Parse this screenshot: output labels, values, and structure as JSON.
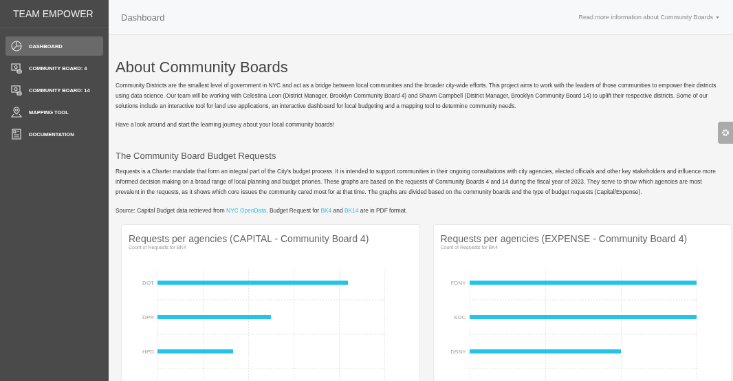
{
  "sidebar": {
    "brand": "TEAM EMPOWER",
    "items": [
      {
        "label": "DASHBOARD",
        "kind": "pie",
        "selected": true
      },
      {
        "label": "COMMUNITY BOARD: 4",
        "kind": "board",
        "selected": false
      },
      {
        "label": "COMMUNITY BOARD: 14",
        "kind": "board",
        "selected": false
      },
      {
        "label": "MAPPING TOOL",
        "kind": "map",
        "selected": false
      },
      {
        "label": "DOCUMENTATION",
        "kind": "doc",
        "selected": false
      }
    ]
  },
  "header": {
    "title": "Dashboard",
    "menu": "Read more information about Community Boards"
  },
  "about": {
    "title": "About Community Boards",
    "paragraphs": [
      "Community Districts are the smallest level of government in NYC and act as a bridge between local communities and the broader city-wide efforts. This project aims to work with the leaders of those communities to empower their districts using data science. Our team will be working with Celestina Leon (District Manager, Brooklyn Community Board 4) and Shawn Campbell (District Manager, Brooklyn Community Board 14) to uplift their respective districts. Some of our solutions include an interactive tool for land use applications, an interactive dashboard for local budgeting and a mapping tool to determine community needs.",
      "Have a look around and start the learning journey about your local community boards!"
    ]
  },
  "budget": {
    "title": "The Community Board Budget Requests",
    "paragraph": "Requests is a Charter mandate that form an integral part of the City's budget process. It is intended to support communities in their ongoing consultations with city agencies, elected officials and other key stakeholders and influence more informed decision making on a broad range of local planning and budget priories. These graphs are based on the requests of Community Boards 4 and 14 during the fiscal year of 2023. They serve to show which agencies are most prevalent in the requests, as it shows which core issues the community cared most for at that time. The graphs are divided based on the community boards and the type of budget requests (Capital/Expense).",
    "source": [
      {
        "text": "Source: Capital Budget data retrieved from ",
        "link": false
      },
      {
        "text": "NYC OpenData",
        "link": true
      },
      {
        "text": ". Budget Request for ",
        "link": false
      },
      {
        "text": "BK4",
        "link": true
      },
      {
        "text": " and ",
        "link": false
      },
      {
        "text": "BK14",
        "link": true
      },
      {
        "text": " are in PDF format.",
        "link": false
      }
    ]
  },
  "charts": [
    {
      "title": "Requests per agencies (CAPITAL - Community Board 4)",
      "subtitle": "Count of Requests for BK4",
      "bars": [
        {
          "label": "DOT"
        },
        {
          "label": "DPR"
        },
        {
          "label": "HPD"
        }
      ]
    },
    {
      "title": "Requests per agencies (EXPENSE - Community Board 4)",
      "subtitle": "Count of Requests for BK4",
      "bars": [
        {
          "label": "FDNY"
        },
        {
          "label": "EDC"
        },
        {
          "label": "DSNY"
        }
      ]
    }
  ]
}
